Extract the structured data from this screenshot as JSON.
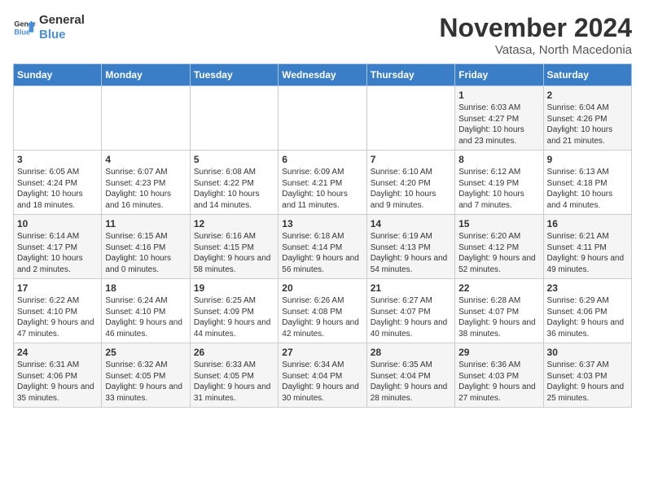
{
  "header": {
    "logo_line1": "General",
    "logo_line2": "Blue",
    "month": "November 2024",
    "location": "Vatasa, North Macedonia"
  },
  "weekdays": [
    "Sunday",
    "Monday",
    "Tuesday",
    "Wednesday",
    "Thursday",
    "Friday",
    "Saturday"
  ],
  "weeks": [
    [
      {
        "day": "",
        "info": ""
      },
      {
        "day": "",
        "info": ""
      },
      {
        "day": "",
        "info": ""
      },
      {
        "day": "",
        "info": ""
      },
      {
        "day": "",
        "info": ""
      },
      {
        "day": "1",
        "info": "Sunrise: 6:03 AM\nSunset: 4:27 PM\nDaylight: 10 hours and 23 minutes."
      },
      {
        "day": "2",
        "info": "Sunrise: 6:04 AM\nSunset: 4:26 PM\nDaylight: 10 hours and 21 minutes."
      }
    ],
    [
      {
        "day": "3",
        "info": "Sunrise: 6:05 AM\nSunset: 4:24 PM\nDaylight: 10 hours and 18 minutes."
      },
      {
        "day": "4",
        "info": "Sunrise: 6:07 AM\nSunset: 4:23 PM\nDaylight: 10 hours and 16 minutes."
      },
      {
        "day": "5",
        "info": "Sunrise: 6:08 AM\nSunset: 4:22 PM\nDaylight: 10 hours and 14 minutes."
      },
      {
        "day": "6",
        "info": "Sunrise: 6:09 AM\nSunset: 4:21 PM\nDaylight: 10 hours and 11 minutes."
      },
      {
        "day": "7",
        "info": "Sunrise: 6:10 AM\nSunset: 4:20 PM\nDaylight: 10 hours and 9 minutes."
      },
      {
        "day": "8",
        "info": "Sunrise: 6:12 AM\nSunset: 4:19 PM\nDaylight: 10 hours and 7 minutes."
      },
      {
        "day": "9",
        "info": "Sunrise: 6:13 AM\nSunset: 4:18 PM\nDaylight: 10 hours and 4 minutes."
      }
    ],
    [
      {
        "day": "10",
        "info": "Sunrise: 6:14 AM\nSunset: 4:17 PM\nDaylight: 10 hours and 2 minutes."
      },
      {
        "day": "11",
        "info": "Sunrise: 6:15 AM\nSunset: 4:16 PM\nDaylight: 10 hours and 0 minutes."
      },
      {
        "day": "12",
        "info": "Sunrise: 6:16 AM\nSunset: 4:15 PM\nDaylight: 9 hours and 58 minutes."
      },
      {
        "day": "13",
        "info": "Sunrise: 6:18 AM\nSunset: 4:14 PM\nDaylight: 9 hours and 56 minutes."
      },
      {
        "day": "14",
        "info": "Sunrise: 6:19 AM\nSunset: 4:13 PM\nDaylight: 9 hours and 54 minutes."
      },
      {
        "day": "15",
        "info": "Sunrise: 6:20 AM\nSunset: 4:12 PM\nDaylight: 9 hours and 52 minutes."
      },
      {
        "day": "16",
        "info": "Sunrise: 6:21 AM\nSunset: 4:11 PM\nDaylight: 9 hours and 49 minutes."
      }
    ],
    [
      {
        "day": "17",
        "info": "Sunrise: 6:22 AM\nSunset: 4:10 PM\nDaylight: 9 hours and 47 minutes."
      },
      {
        "day": "18",
        "info": "Sunrise: 6:24 AM\nSunset: 4:10 PM\nDaylight: 9 hours and 46 minutes."
      },
      {
        "day": "19",
        "info": "Sunrise: 6:25 AM\nSunset: 4:09 PM\nDaylight: 9 hours and 44 minutes."
      },
      {
        "day": "20",
        "info": "Sunrise: 6:26 AM\nSunset: 4:08 PM\nDaylight: 9 hours and 42 minutes."
      },
      {
        "day": "21",
        "info": "Sunrise: 6:27 AM\nSunset: 4:07 PM\nDaylight: 9 hours and 40 minutes."
      },
      {
        "day": "22",
        "info": "Sunrise: 6:28 AM\nSunset: 4:07 PM\nDaylight: 9 hours and 38 minutes."
      },
      {
        "day": "23",
        "info": "Sunrise: 6:29 AM\nSunset: 4:06 PM\nDaylight: 9 hours and 36 minutes."
      }
    ],
    [
      {
        "day": "24",
        "info": "Sunrise: 6:31 AM\nSunset: 4:06 PM\nDaylight: 9 hours and 35 minutes."
      },
      {
        "day": "25",
        "info": "Sunrise: 6:32 AM\nSunset: 4:05 PM\nDaylight: 9 hours and 33 minutes."
      },
      {
        "day": "26",
        "info": "Sunrise: 6:33 AM\nSunset: 4:05 PM\nDaylight: 9 hours and 31 minutes."
      },
      {
        "day": "27",
        "info": "Sunrise: 6:34 AM\nSunset: 4:04 PM\nDaylight: 9 hours and 30 minutes."
      },
      {
        "day": "28",
        "info": "Sunrise: 6:35 AM\nSunset: 4:04 PM\nDaylight: 9 hours and 28 minutes."
      },
      {
        "day": "29",
        "info": "Sunrise: 6:36 AM\nSunset: 4:03 PM\nDaylight: 9 hours and 27 minutes."
      },
      {
        "day": "30",
        "info": "Sunrise: 6:37 AM\nSunset: 4:03 PM\nDaylight: 9 hours and 25 minutes."
      }
    ]
  ]
}
